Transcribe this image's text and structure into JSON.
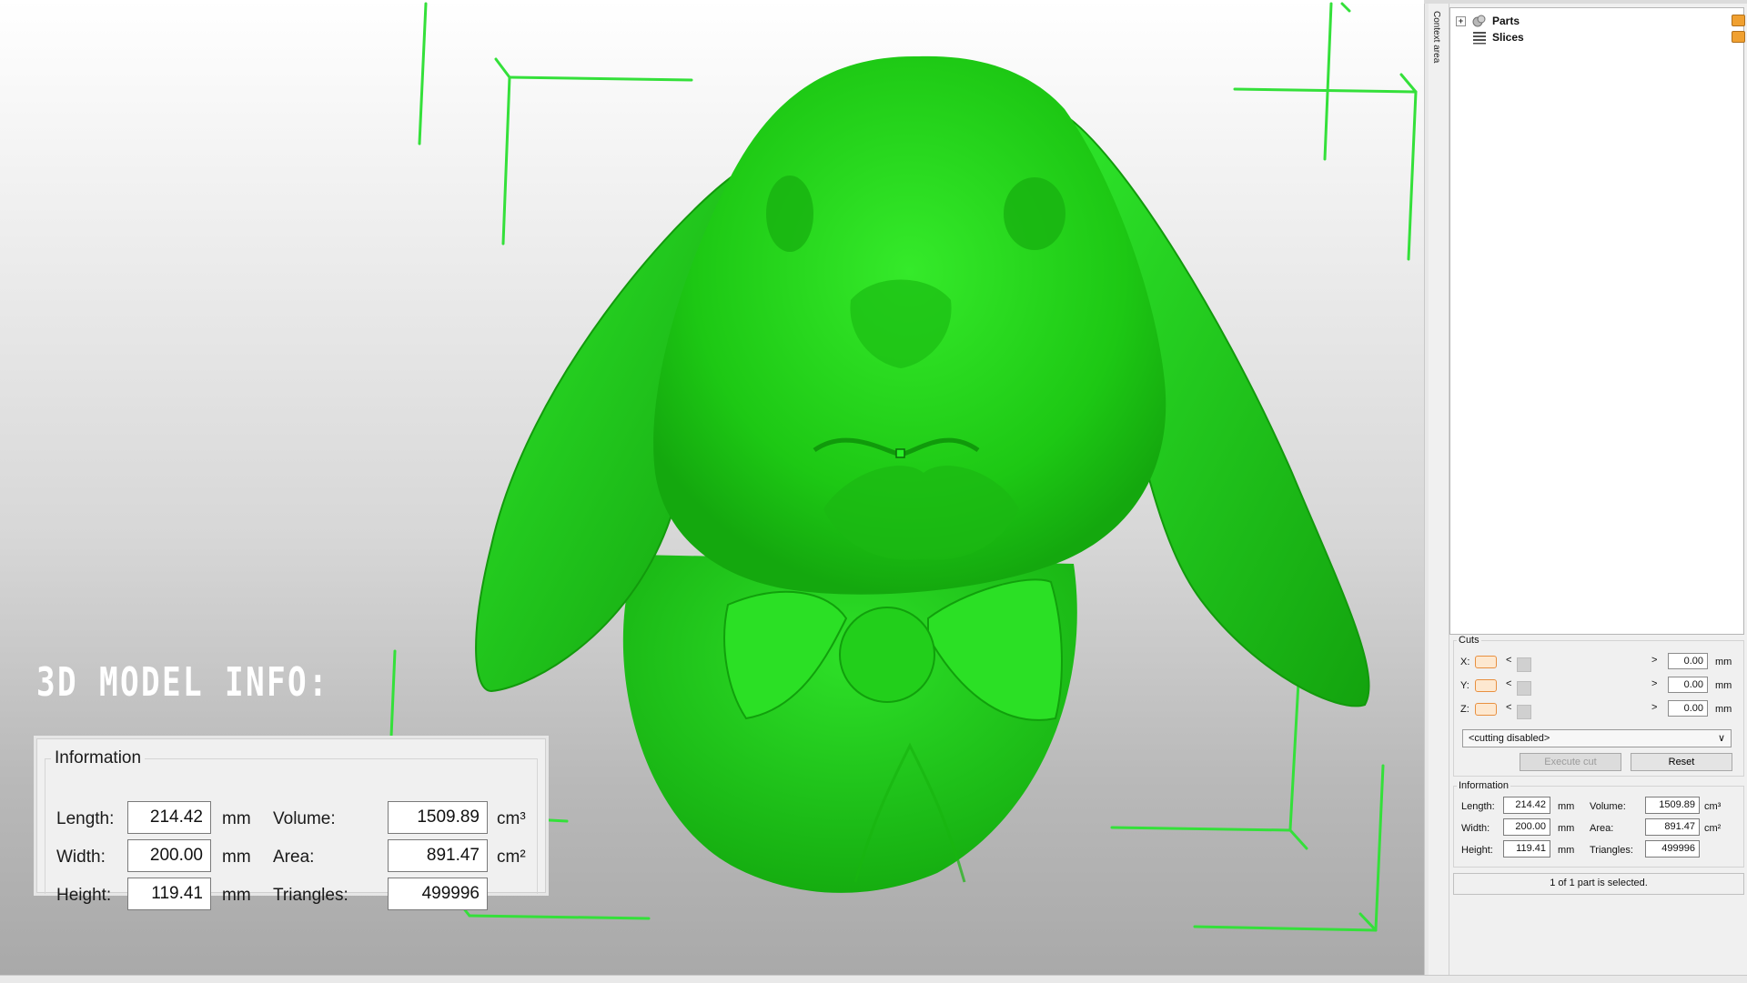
{
  "overlay": {
    "title": "3D MODEL INFO:",
    "group_title": "Information",
    "length_label": "Length:",
    "length_value": "214.42",
    "length_unit": "mm",
    "width_label": "Width:",
    "width_value": "200.00",
    "width_unit": "mm",
    "height_label": "Height:",
    "height_value": "119.41",
    "height_unit": "mm",
    "volume_label": "Volume:",
    "volume_value": "1509.89",
    "volume_unit": "cm³",
    "area_label": "Area:",
    "area_value": "891.47",
    "area_unit": "cm²",
    "triangles_label": "Triangles:",
    "triangles_value": "499996"
  },
  "context_label": "Context area",
  "tree": {
    "parts_label": "Parts",
    "slices_label": "Slices"
  },
  "cuts": {
    "title": "Cuts",
    "x_label": "X:",
    "y_label": "Y:",
    "z_label": "Z:",
    "x_value": "0.00",
    "y_value": "0.00",
    "z_value": "0.00",
    "unit": "mm",
    "arrow_left": "<",
    "arrow_right": ">",
    "mode": "<cutting disabled>",
    "execute_label": "Execute cut",
    "reset_label": "Reset"
  },
  "info": {
    "title": "Information",
    "length_label": "Length:",
    "length_value": "214.42",
    "length_unit": "mm",
    "width_label": "Width:",
    "width_value": "200.00",
    "width_unit": "mm",
    "height_label": "Height:",
    "height_value": "119.41",
    "height_unit": "mm",
    "volume_label": "Volume:",
    "volume_value": "1509.89",
    "volume_unit": "cm³",
    "area_label": "Area:",
    "area_value": "891.47",
    "area_unit": "cm²",
    "triangles_label": "Triangles:",
    "triangles_value": "499996"
  },
  "status": "1 of 1 part is selected.",
  "colors": {
    "model": "#22d11a",
    "bounding_lines": "#34e03a",
    "checkbox_border": "#e89040"
  }
}
